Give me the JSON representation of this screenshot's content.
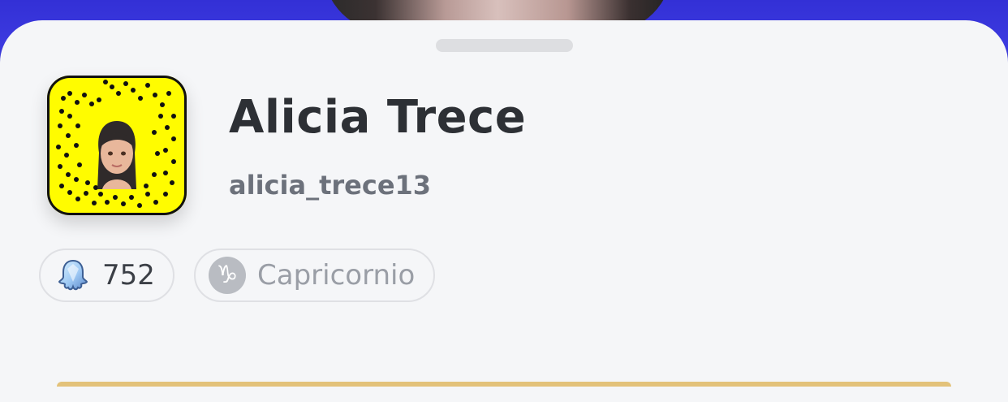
{
  "profile": {
    "display_name": "Alicia Trece",
    "username": "alicia_trece13"
  },
  "chips": {
    "snap_score": "752",
    "zodiac": "Capricornio",
    "zodiac_symbol": "♑"
  },
  "icons": {
    "score": "ghost-icon",
    "zodiac": "capricorn-icon"
  },
  "colors": {
    "header_background": "#3a38d8",
    "snapcode_yellow": "#fffc00",
    "sheet_background": "#f5f6f8"
  }
}
